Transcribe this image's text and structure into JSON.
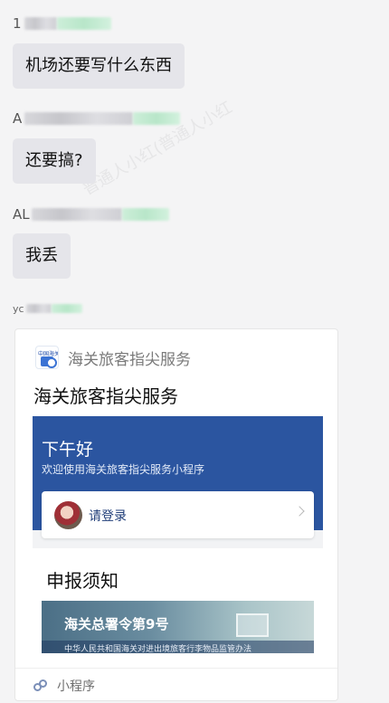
{
  "messages": [
    {
      "sender_initial": "1",
      "text": "机场还要写什么东西"
    },
    {
      "sender_initial": "A",
      "text": "还要搞?"
    },
    {
      "sender_initial": "AL",
      "text": "我丢"
    }
  ],
  "card": {
    "sender_prefix": "yc",
    "app_name": "海关旅客指尖服务",
    "title": "海关旅客指尖服务",
    "logo_text": "中国海关",
    "preview": {
      "greeting": "下午好",
      "welcome": "欢迎使用海关旅客指尖服务小程序",
      "login_label": "请登录",
      "notice_title": "申报须知",
      "banner_title": "海关总署令第9号",
      "banner_subtitle": "中华人民共和国海关对进出境旅客行李物品监管办法"
    },
    "footer_label": "小程序"
  },
  "watermark": "普通人小红(普通人小红"
}
